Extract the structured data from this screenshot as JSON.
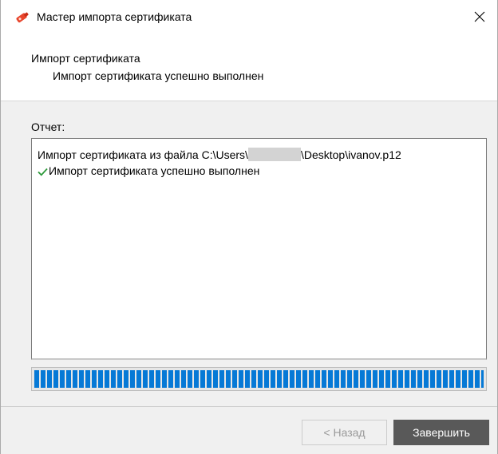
{
  "window": {
    "title": "Мастер импорта сертификата",
    "close_glyph": "✕"
  },
  "header": {
    "title": "Импорт сертификата",
    "subtitle": "Импорт сертификата успешно выполнен"
  },
  "report": {
    "label": "Отчет:",
    "line1_prefix": "Импорт сертификата из файла C:\\Users\\",
    "line1_suffix": "\\Desktop\\ivanov.p12",
    "line2": "Импорт сертификата успешно выполнен"
  },
  "progress": {
    "value": 1.0
  },
  "buttons": {
    "back_label": "< Назад",
    "finish_label": "Завершить"
  },
  "colors": {
    "progress_fill": "#0679d6",
    "success_check": "#2e9a3c",
    "primary_button": "#595959"
  },
  "icons": {
    "app": "certificate-wizard-icon",
    "close": "close-icon",
    "status": "checkmark-icon"
  }
}
